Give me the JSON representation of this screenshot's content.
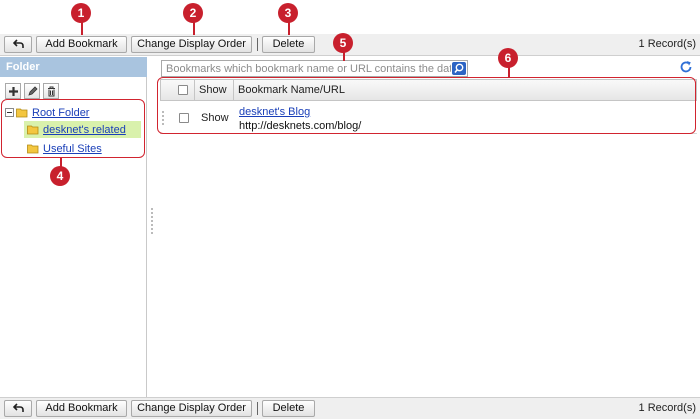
{
  "toolbar": {
    "back_label": "",
    "add_bookmark": "Add Bookmark",
    "change_order": "Change Display Order",
    "delete": "Delete",
    "record_count": "1 Record(s)"
  },
  "folder_panel": {
    "header": "Folder",
    "tree": [
      {
        "label": "Root Folder",
        "expanded": true
      },
      {
        "label": "desknet's related",
        "selected": true
      },
      {
        "label": "Useful Sites"
      }
    ]
  },
  "search": {
    "placeholder": "Bookmarks which bookmark name or URL contains the data ..."
  },
  "table": {
    "columns": [
      "Show",
      "Bookmark Name/URL"
    ],
    "rows": [
      {
        "show": "Show",
        "name": "desknet's Blog",
        "url": "http://desknets.com/blog/"
      }
    ]
  },
  "callouts": [
    "1",
    "2",
    "3",
    "4",
    "5",
    "6"
  ],
  "colors": {
    "accent": "#c8202d",
    "folder_header": "#a9c4df",
    "selected_row": "#d9f1ac",
    "link": "#1a3fb8"
  }
}
